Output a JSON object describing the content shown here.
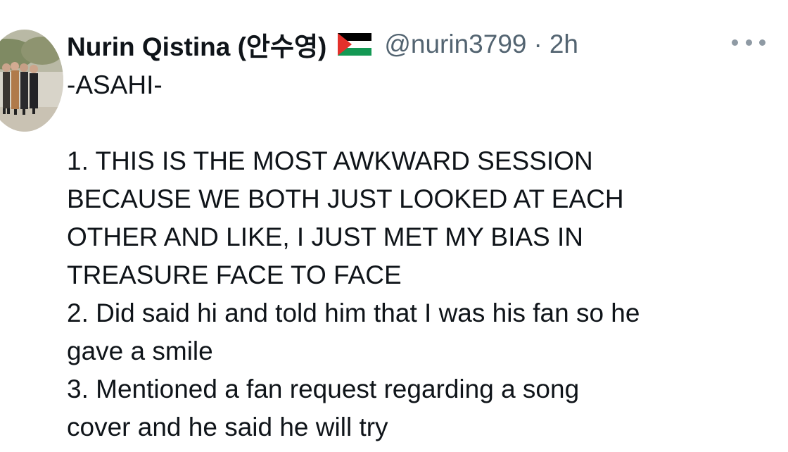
{
  "tweet": {
    "author_name": "Nurin Qistina (안수영)",
    "flag_icon": "palestine-flag-icon",
    "handle": "@nurin3799",
    "separator": "·",
    "time": "2h",
    "more_icon": "more-horizontal-icon",
    "lines": [
      "-ASAHI-",
      " ",
      "1. THIS IS THE MOST AWKWARD SESSION",
      "BECAUSE WE BOTH JUST LOOKED AT EACH",
      "OTHER AND LIKE, I JUST MET MY BIAS IN",
      "TREASURE FACE TO FACE",
      "2. Did said hi and told him that I was his fan so he",
      "gave a smile",
      "3. Mentioned a fan request regarding a song",
      "cover and he said he will try"
    ]
  },
  "colors": {
    "text": "#0f1419",
    "secondary": "#536471",
    "flag_black": "#000000",
    "flag_green": "#149954",
    "flag_red": "#e4312b"
  }
}
